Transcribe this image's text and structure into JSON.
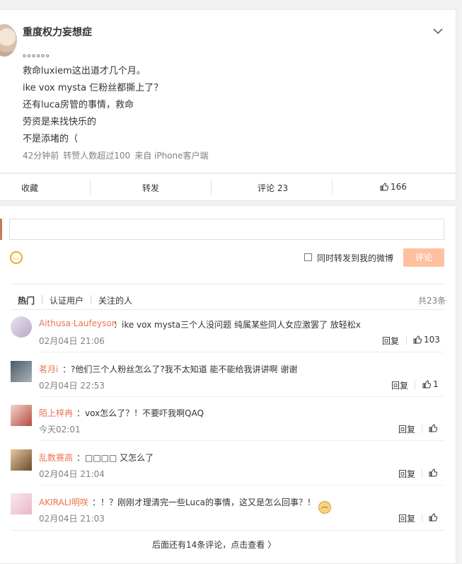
{
  "post": {
    "author": "重度权力妄想症",
    "lines": [
      "。。。。。。",
      "救命luxiem这出道才几个月。",
      "ike vox mysta 仨粉丝都撕上了？",
      "还有luca房管的事情，救命",
      "劳资是来找快乐的",
      "不是添堵的（"
    ],
    "meta": {
      "time": "42分钟前",
      "repost": "转赞人数超过100",
      "source": "来自 iPhone客户端"
    }
  },
  "actions": {
    "collect": "收藏",
    "forward": "转发",
    "comment": "评论 23",
    "like_count": "166"
  },
  "comment_box": {
    "placeholder": "",
    "repost_label": "同时转发到我的微博",
    "submit": "评论"
  },
  "tabs": {
    "hot": "热门",
    "verified": "认证用户",
    "following": "关注的人",
    "total": "共23条"
  },
  "comments": [
    {
      "name": "Aithusa·Laufeyson",
      "text": "：ike vox mysta三个人没问题 纯属某些同人女应激罢了 放轻松x",
      "time": "02月04日 21:06",
      "reply": "回复",
      "likes": "103"
    },
    {
      "name": "茗月i",
      "text": "：?他们三个人粉丝怎么了?我不太知道 能不能给我讲讲啊 谢谢",
      "time": "02月04日 22:53",
      "reply": "回复",
      "likes": "1"
    },
    {
      "name": "陌上梓冉",
      "text": "：vox怎么了？！不要吓我啊QAQ",
      "time": "今天02:01",
      "reply": "回复",
      "likes": ""
    },
    {
      "name": "乱数赛高",
      "text": "：□□□□ 又怎么了",
      "time": "02月04日 21:04",
      "reply": "回复",
      "likes": ""
    },
    {
      "name": "AKIRALI明咲",
      "text": "：！？刚刚才理清完一些Luca的事情，这又是怎么回事？！",
      "time": "02月04日 21:03",
      "reply": "回复",
      "likes": ""
    }
  ],
  "more": "后面还有14条评论，点击查看 〉",
  "icons": {
    "menu": "chevron-down-icon",
    "like": "thumbs-up-icon",
    "emoji": "smiley-icon"
  },
  "colors": {
    "accent": "#eb7350",
    "submit_bg": "#ffc09f",
    "link": "#eb7350"
  }
}
